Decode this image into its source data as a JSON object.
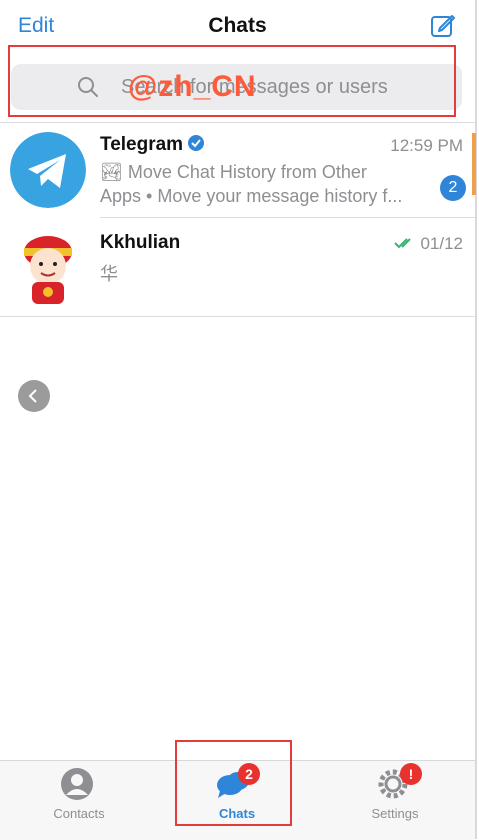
{
  "header": {
    "edit_label": "Edit",
    "title": "Chats",
    "compose_icon": "compose-icon"
  },
  "search": {
    "placeholder": "Search for messages or users",
    "overlay_text": "@zh_CN"
  },
  "chats": [
    {
      "name": "Telegram",
      "verified": true,
      "time": "12:59 PM",
      "preview_line1": "🏞 Move Chat History from Other",
      "preview_line2": "Apps • Move your message history f...",
      "unread": "2"
    },
    {
      "name": "Kkhulian",
      "verified": false,
      "time": "01/12",
      "status": "read",
      "preview_line1": "华"
    }
  ],
  "tabbar": {
    "tabs": [
      {
        "label": "Contacts",
        "active": false
      },
      {
        "label": "Chats",
        "active": true,
        "badge": "2"
      },
      {
        "label": "Settings",
        "active": false,
        "badge": "!"
      }
    ]
  },
  "colors": {
    "accent": "#2f86d8",
    "badge_red": "#e8322e",
    "highlight": "#e43b3b",
    "overlay": "#ff5b3a"
  }
}
